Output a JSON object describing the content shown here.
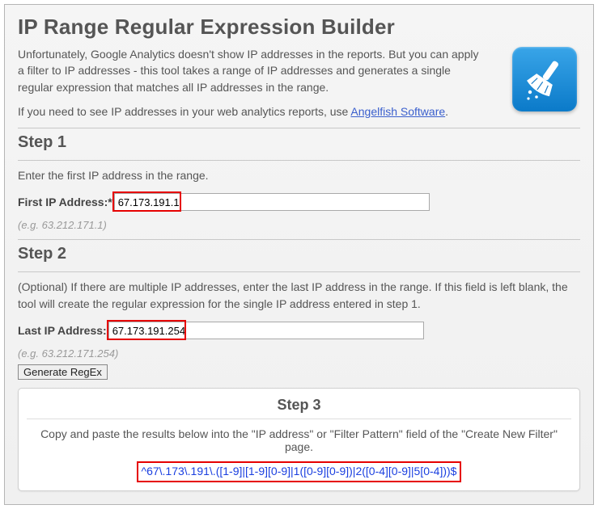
{
  "title": "IP Range Regular Expression Builder",
  "intro": {
    "p1": "Unfortunately, Google Analytics doesn't show IP addresses in the reports. But you can apply a filter to IP addresses - this tool takes a range of IP addresses and generates a single regular expression that matches all IP addresses in the range.",
    "p2_prefix": "If you need to see IP addresses in your web analytics reports, use ",
    "p2_link": "Angelfish Software",
    "p2_suffix": "."
  },
  "step1": {
    "heading": "Step 1",
    "desc": "Enter the first IP address in the range.",
    "label": "First IP Address:*",
    "value": "67.173.191.1",
    "hint": "(e.g. 63.212.171.1)"
  },
  "step2": {
    "heading": "Step 2",
    "desc": "(Optional) If there are multiple IP addresses, enter the last IP address in the range. If this field is left blank, the tool will create the regular expression for the single IP address entered in step 1.",
    "label": "Last IP Address:",
    "value": "67.173.191.254",
    "hint": "(e.g. 63.212.171.254)"
  },
  "button": {
    "generate": "Generate RegEx"
  },
  "step3": {
    "heading": "Step 3",
    "desc": "Copy and paste the results below into the \"IP address\" or \"Filter Pattern\" field of the \"Create New Filter\" page.",
    "regex": "^67\\.173\\.191\\.([1-9]|[1-9][0-9]|1([0-9][0-9])|2([0-4][0-9]|5[0-4]))$"
  }
}
